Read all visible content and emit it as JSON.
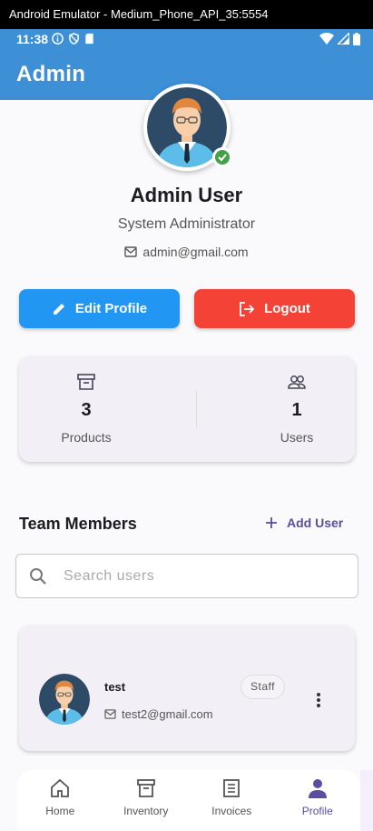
{
  "window": {
    "title": "Android Emulator - Medium_Phone_API_35:5554"
  },
  "statusbar": {
    "time": "11:38"
  },
  "appbar": {
    "title": "Admin"
  },
  "profile": {
    "name": "Admin User",
    "role": "System Administrator",
    "email": "admin@gmail.com",
    "verified_icon": "check-badge-icon"
  },
  "actions": {
    "edit_label": "Edit Profile",
    "logout_label": "Logout"
  },
  "stats": [
    {
      "icon": "archive-box-icon",
      "value": "3",
      "label": "Products"
    },
    {
      "icon": "users-icon",
      "value": "1",
      "label": "Users"
    }
  ],
  "team": {
    "title": "Team Members",
    "add_label": "Add User",
    "search_placeholder": "Search users",
    "members": [
      {
        "name": "test",
        "role_badge": "Staff",
        "email": "test2@gmail.com"
      }
    ]
  },
  "nav": {
    "items": [
      {
        "label": "Home",
        "icon": "home-icon",
        "active": false
      },
      {
        "label": "Inventory",
        "icon": "inventory-icon",
        "active": false
      },
      {
        "label": "Invoices",
        "icon": "invoice-icon",
        "active": false
      },
      {
        "label": "Profile",
        "icon": "person-icon",
        "active": true
      }
    ]
  },
  "colors": {
    "primary": "#3d8fd6",
    "edit_button": "#2196f3",
    "logout_button": "#f44336",
    "accent": "#5b4ea0",
    "verified": "#43a047"
  }
}
